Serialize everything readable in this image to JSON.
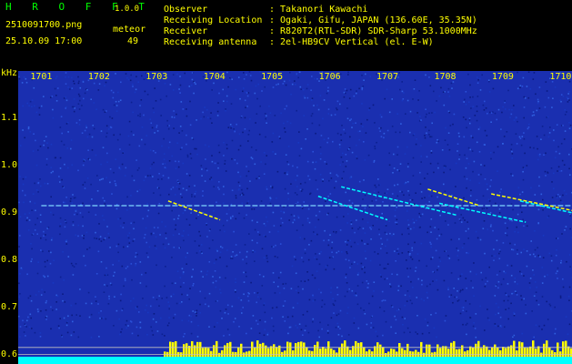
{
  "header": {
    "app_name": "H R O F F T",
    "version": "1.0.0",
    "filename": "2510091700.png",
    "mode_label": "meteor",
    "datetime": "25.10.09 17:00",
    "count": "49",
    "info": [
      {
        "label": "Observer",
        "value": ": Takanori Kawachi"
      },
      {
        "label": "Receiving Location",
        "value": ": Ogaki, Gifu, JAPAN (136.60E, 35.35N)"
      },
      {
        "label": "Receiver",
        "value": ": R820T2(RTL-SDR) SDR-Sharp 53.1000MHz"
      },
      {
        "label": "Receiving antenna",
        "value": ": 2el-HB9CV Vertical (el. E-W)"
      }
    ]
  },
  "chart_data": {
    "type": "heatmap",
    "ylabel": "kHz",
    "y_ticks": [
      "1.1",
      "1.0",
      "0.9",
      "0.8",
      "0.7",
      "0.6"
    ],
    "x_ticks": [
      "1701",
      "1702",
      "1703",
      "1704",
      "1705",
      "1706",
      "1707",
      "1708",
      "1709",
      "1710"
    ],
    "ylim": [
      0.58,
      1.2
    ],
    "xlim": [
      1700.6,
      1710.2
    ],
    "colors": {
      "background": "#1a2fb0",
      "trace": "#00ffff",
      "hot": "#ffff00",
      "level_low": "#00ffff",
      "level_high": "#ffff00"
    }
  }
}
